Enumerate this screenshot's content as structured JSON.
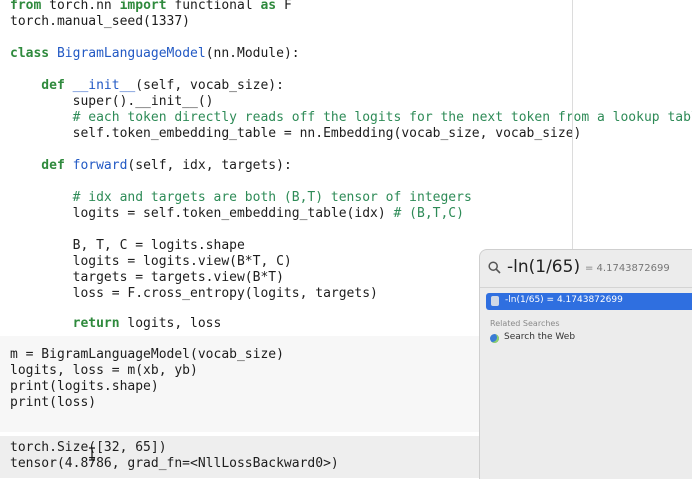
{
  "code": {
    "line0a": "from",
    "line0b": " torch.nn ",
    "line0c": "import",
    "line0d": " functional ",
    "line0e": "as",
    "line0f": " F",
    "line1": "torch.manual_seed(1337)",
    "line3a": "class",
    "line3b": " BigramLanguageModel",
    "line3c": "(nn.Module):",
    "line5a": "    def",
    "line5b": " __init__",
    "line5c": "(self, vocab_size):",
    "line6": "        super().__init__()",
    "line7": "        # each token directly reads off the logits for the next token from a lookup table",
    "line8": "        self.token_embedding_table = nn.Embedding(vocab_size, vocab_size)",
    "line10a": "    def",
    "line10b": " forward",
    "line10c": "(self, idx, targets):",
    "line12": "        # idx and targets are both (B,T) tensor of integers",
    "line13a": "        logits = self.token_embedding_table(idx) ",
    "line13b": "# (B,T,C)",
    "line15": "        B, T, C = logits.shape",
    "line16": "        logits = logits.view(B*T, C)",
    "line17": "        targets = targets.view(B*T)",
    "line18": "        loss = F.cross_entropy(logits, targets)",
    "line20a": "        return",
    "line20b": " logits, loss"
  },
  "cell2": {
    "l1": "m = BigramLanguageModel(vocab_size)",
    "l2": "logits, loss = m(xb, yb)",
    "l3": "print(logits.shape)",
    "l4": "print(loss)"
  },
  "output": {
    "l1": "torch.Size([32, 65])",
    "l2": "tensor(4.8786, grad_fn=<NllLossBackward0>)"
  },
  "spotlight": {
    "query": "-ln(1/65)",
    "inline_result": "= 4.1743872699",
    "top_hit": "-ln(1/65) = 4.1743872699",
    "section_title": "Related Searches",
    "web_search": "Search the Web"
  }
}
